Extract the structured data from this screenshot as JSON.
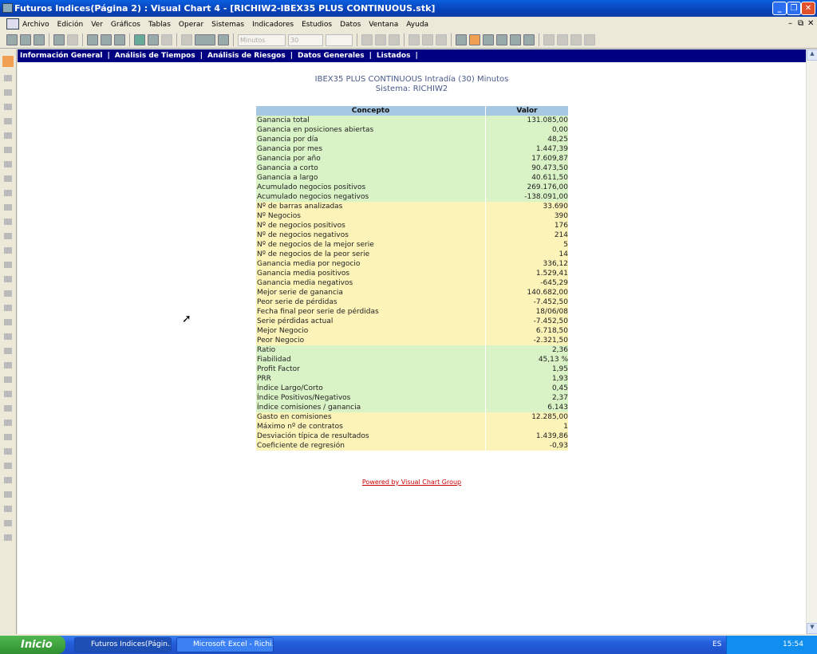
{
  "window": {
    "title": "Futuros Indices(Página 2) : Visual Chart 4 - [RICHIW2-IBEX35 PLUS CONTINUOUS.stk]"
  },
  "menu": [
    "Archivo",
    "Edición",
    "Ver",
    "Gráficos",
    "Tablas",
    "Operar",
    "Sistemas",
    "Indicadores",
    "Estudios",
    "Datos",
    "Ventana",
    "Ayuda"
  ],
  "toolbar": {
    "period": "Minutos",
    "interval": "30",
    "extra": ""
  },
  "nav": [
    "Información General",
    "Análisis de Tiempos",
    "Análisis de Riesgos",
    "Datos Generales",
    "Listados"
  ],
  "report": {
    "title": "IBEX35 PLUS CONTINUOUS Intradía (30) Minutos",
    "subtitle": "Sistema: RICHIW2",
    "headers": [
      "Concepto",
      "Valor"
    ],
    "rows": [
      [
        "Ganancia total",
        "131.085,00",
        "g"
      ],
      [
        "Ganancia en posiciones abiertas",
        "0,00",
        "g"
      ],
      [
        "Ganancia por día",
        "48,25",
        "g"
      ],
      [
        "Ganancia por mes",
        "1.447,39",
        "g"
      ],
      [
        "Ganancia por año",
        "17.609,87",
        "g"
      ],
      [
        "Ganancia a corto",
        "90.473,50",
        "g"
      ],
      [
        "Ganancia a largo",
        "40.611,50",
        "g"
      ],
      [
        "Acumulado negocios positivos",
        "269.176,00",
        "g"
      ],
      [
        "Acumulado negocios negativos",
        "-138.091,00",
        "g"
      ],
      [
        "Nº de barras analizadas",
        "33.690",
        "y"
      ],
      [
        "Nº Negocios",
        "390",
        "y"
      ],
      [
        "Nº de negocios positivos",
        "176",
        "y"
      ],
      [
        "Nº de negocios negativos",
        "214",
        "y"
      ],
      [
        "Nº de negocios de la mejor serie",
        "5",
        "y"
      ],
      [
        "Nº de negocios de la peor serie",
        "14",
        "y"
      ],
      [
        "Ganancia media por negocio",
        "336,12",
        "y"
      ],
      [
        "Ganancia media positivos",
        "1.529,41",
        "y"
      ],
      [
        "Ganancia media negativos",
        "-645,29",
        "y"
      ],
      [
        "Mejor serie de ganancia",
        "140.682,00",
        "y"
      ],
      [
        "Peor serie de pérdidas",
        "-7.452,50",
        "y"
      ],
      [
        "Fecha final peor serie de pérdidas",
        "18/06/08",
        "y"
      ],
      [
        "Serie pérdidas actual",
        "-7.452,50",
        "y"
      ],
      [
        "Mejor Negocio",
        "6.718,50",
        "y"
      ],
      [
        "Peor Negocio",
        "-2.321,50",
        "y"
      ],
      [
        "Ratio",
        "2,36",
        "g"
      ],
      [
        "Fiabilidad",
        "45,13 %",
        "g"
      ],
      [
        "Profit Factor",
        "1,95",
        "g"
      ],
      [
        "PRR",
        "1,93",
        "g"
      ],
      [
        "Índice Largo/Corto",
        "0,45",
        "g"
      ],
      [
        "Índice Positivos/Negativos",
        "2,37",
        "g"
      ],
      [
        "Índice comisiones / ganancia",
        "6.143",
        "g"
      ],
      [
        "Gasto en comisiones",
        "12.285,00",
        "y"
      ],
      [
        "Máximo nº de contratos",
        "1",
        "y"
      ],
      [
        "Desviación típica de resultados",
        "1.439,86",
        "y"
      ],
      [
        "Coeficiente de regresión",
        "-0,93",
        "y"
      ]
    ],
    "powered": "Powered by Visual Chart Group"
  },
  "taskbar": {
    "start": "Inicio",
    "tasks": [
      "Futuros Indices(Págin...",
      "Microsoft Excel - Richi..."
    ],
    "lang": "ES",
    "clock": "15:54"
  }
}
